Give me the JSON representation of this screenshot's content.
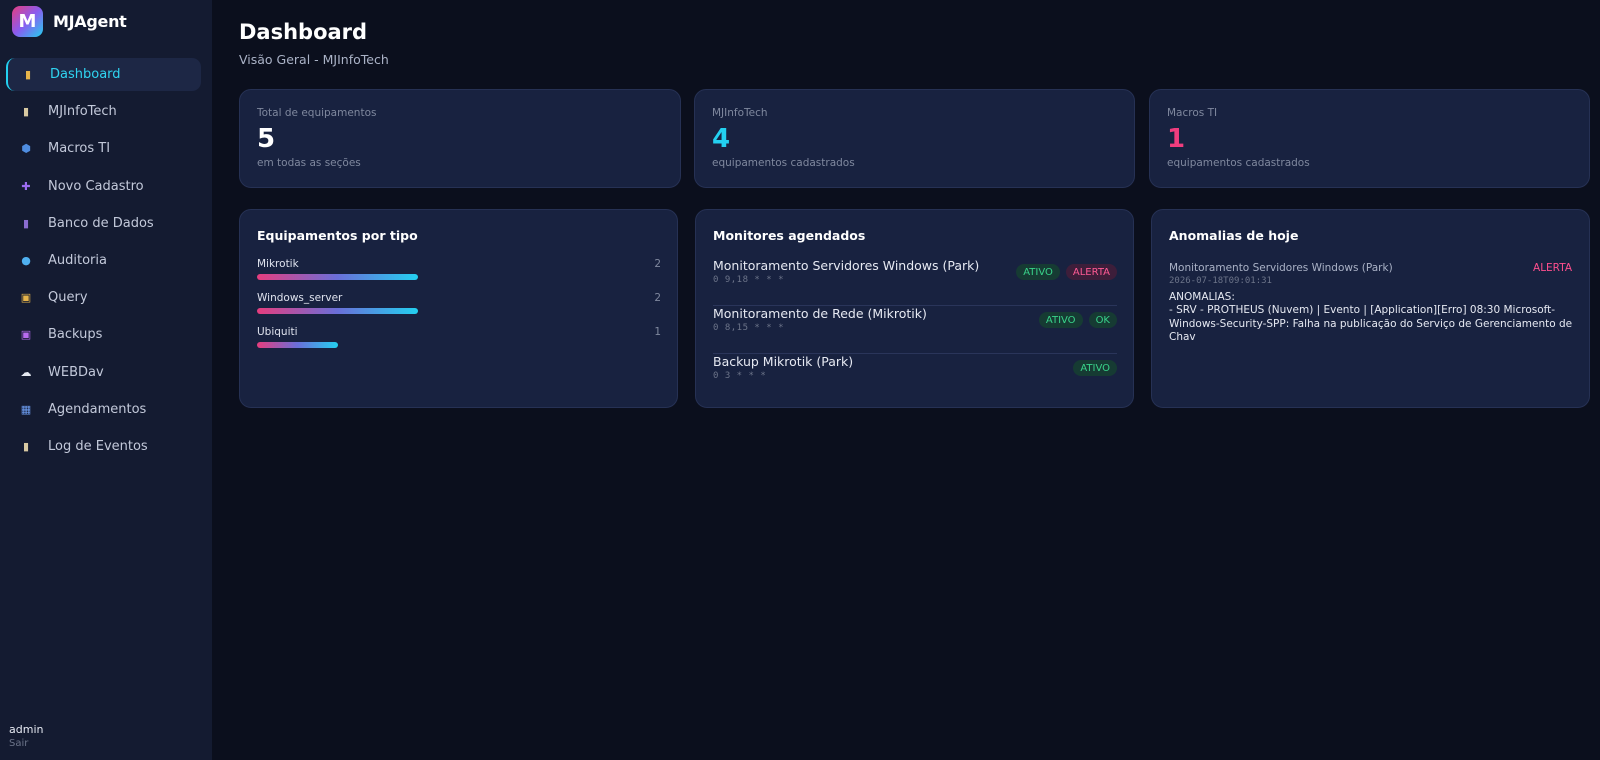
{
  "brand": {
    "logo_letter": "M",
    "name": "MJAgent"
  },
  "nav": [
    {
      "icon": "bar-chart-icon",
      "glyph": "▮",
      "color": "#e6b44a",
      "label": "Dashboard",
      "active": true
    },
    {
      "icon": "clipboard-icon",
      "glyph": "▮",
      "color": "#d8c9a2",
      "label": "MJInfoTech"
    },
    {
      "icon": "shield-icon",
      "glyph": "⬢",
      "color": "#4f8de0",
      "label": "Macros TI"
    },
    {
      "icon": "plus-icon",
      "glyph": "✚",
      "color": "#9b6cf0",
      "label": "Novo Cadastro"
    },
    {
      "icon": "database-icon",
      "glyph": "▮",
      "color": "#8a6cd0",
      "label": "Banco de Dados"
    },
    {
      "icon": "magnifier-icon",
      "glyph": "●",
      "color": "#4fb0f0",
      "label": "Auditoria"
    },
    {
      "icon": "query-icon",
      "glyph": "▣",
      "color": "#e6b44a",
      "label": "Query"
    },
    {
      "icon": "floppy-disk-icon",
      "glyph": "▣",
      "color": "#b86cf0",
      "label": "Backups"
    },
    {
      "icon": "cloud-icon",
      "glyph": "☁",
      "color": "#e6e9f2",
      "label": "WEBDav"
    },
    {
      "icon": "calendar-icon",
      "glyph": "▦",
      "color": "#6c9cf0",
      "label": "Agendamentos"
    },
    {
      "icon": "clipboard-log-icon",
      "glyph": "▮",
      "color": "#d8c9a2",
      "label": "Log de Eventos"
    }
  ],
  "user": {
    "name": "admin",
    "logout": "Sair"
  },
  "header": {
    "title": "Dashboard",
    "subtitle": "Visão Geral - MJInfoTech"
  },
  "stats": [
    {
      "label": "Total de equipamentos",
      "value": "5",
      "note": "em todas as seções",
      "color": "#ffffff"
    },
    {
      "label": "MJInfoTech",
      "value": "4",
      "note": "equipamentos cadastrados",
      "color": "#23d0f0"
    },
    {
      "label": "Macros TI",
      "value": "1",
      "note": "equipamentos cadastrados",
      "color": "#f03d7e"
    }
  ],
  "types": {
    "title": "Equipamentos por tipo",
    "max": 2,
    "items": [
      {
        "name": "Mikrotik",
        "count": 2
      },
      {
        "name": "Windows_server",
        "count": 2
      },
      {
        "name": "Ubiquiti",
        "count": 1
      }
    ]
  },
  "monitors": {
    "title": "Monitores agendados",
    "items": [
      {
        "name": "Monitoramento Servidores Windows (Park)",
        "cron": "0 9,18 * * *",
        "badges": [
          {
            "text": "ATIVO",
            "kind": "ativo"
          },
          {
            "text": "ALERTA",
            "kind": "alerta"
          }
        ]
      },
      {
        "name": "Monitoramento de Rede (Mikrotik)",
        "cron": "0 8,15 * * *",
        "badges": [
          {
            "text": "ATIVO",
            "kind": "ativo"
          },
          {
            "text": "OK",
            "kind": "ok"
          }
        ]
      },
      {
        "name": "Backup Mikrotik (Park)",
        "cron": "0 3 * * *",
        "badges": [
          {
            "text": "ATIVO",
            "kind": "ativo"
          }
        ]
      }
    ]
  },
  "anomalies": {
    "title": "Anomalias de hoje",
    "item": {
      "name": "Monitoramento Servidores Windows (Park)",
      "flag": "ALERTA",
      "time": "2026-07-18T09:01:31",
      "heading": "ANOMALIAS:",
      "text": "- SRV - PROTHEUS (Nuvem) | Evento | [Application][Erro] 08:30 Microsoft-Windows-Security-SPP: Falha na publicação do Serviço de Gerenciamento de Chav"
    }
  }
}
